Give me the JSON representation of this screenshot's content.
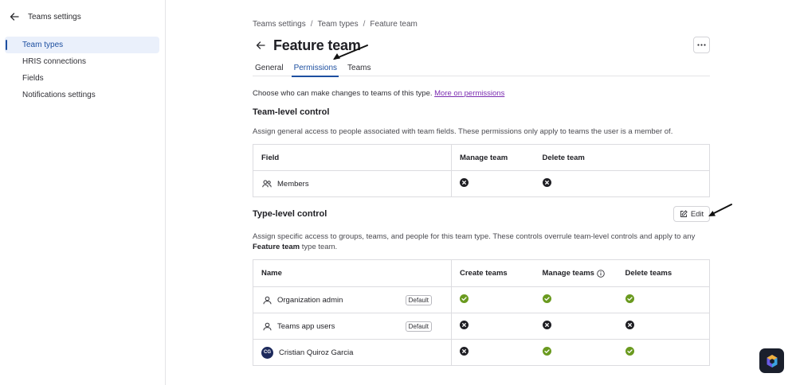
{
  "sidebar": {
    "title": "Teams settings",
    "items": [
      {
        "label": "Team types",
        "active": true
      },
      {
        "label": "HRIS connections",
        "active": false
      },
      {
        "label": "Fields",
        "active": false
      },
      {
        "label": "Notifications settings",
        "active": false
      }
    ]
  },
  "breadcrumb": [
    "Teams settings",
    "Team types",
    "Feature team"
  ],
  "breadcrumb_separator": "/",
  "page": {
    "title": "Feature team"
  },
  "tabs": [
    {
      "label": "General",
      "active": false
    },
    {
      "label": "Permissions",
      "active": true
    },
    {
      "label": "Teams",
      "active": false
    }
  ],
  "intro": {
    "text": "Choose who can make changes to teams of this type.",
    "link": "More on permissions"
  },
  "team_level": {
    "title": "Team-level control",
    "description": "Assign general access to people associated with team fields. These permissions only apply to teams the user is a member of.",
    "columns": [
      "Field",
      "Manage team",
      "Delete team"
    ],
    "rows": [
      {
        "name": "Members",
        "icon": "people-icon",
        "manage_team": "denied",
        "delete_team": "denied"
      }
    ]
  },
  "type_level": {
    "title": "Type-level control",
    "edit_label": "Edit",
    "description_before": "Assign specific access to groups, teams, and people for this team type. These controls overrule team-level controls and apply to any",
    "description_bold": "Feature team",
    "description_after": "type team.",
    "columns": [
      "Name",
      "Create teams",
      "Manage teams",
      "Delete teams"
    ],
    "rows": [
      {
        "name": "Organization admin",
        "icon": "person-icon",
        "badge": "Default",
        "create": "allowed",
        "manage": "allowed",
        "delete": "allowed"
      },
      {
        "name": "Teams app users",
        "icon": "person-icon",
        "badge": "Default",
        "create": "denied",
        "manage": "denied",
        "delete": "denied"
      },
      {
        "name": "Cristian Quiroz Garcia",
        "avatar": "CG",
        "create": "denied",
        "manage": "allowed",
        "delete": "allowed"
      }
    ]
  },
  "colors": {
    "accent": "#1d4fa0",
    "allowed": "#6a9a1f",
    "denied": "#1f1f24",
    "link": "#7a2bb0"
  }
}
